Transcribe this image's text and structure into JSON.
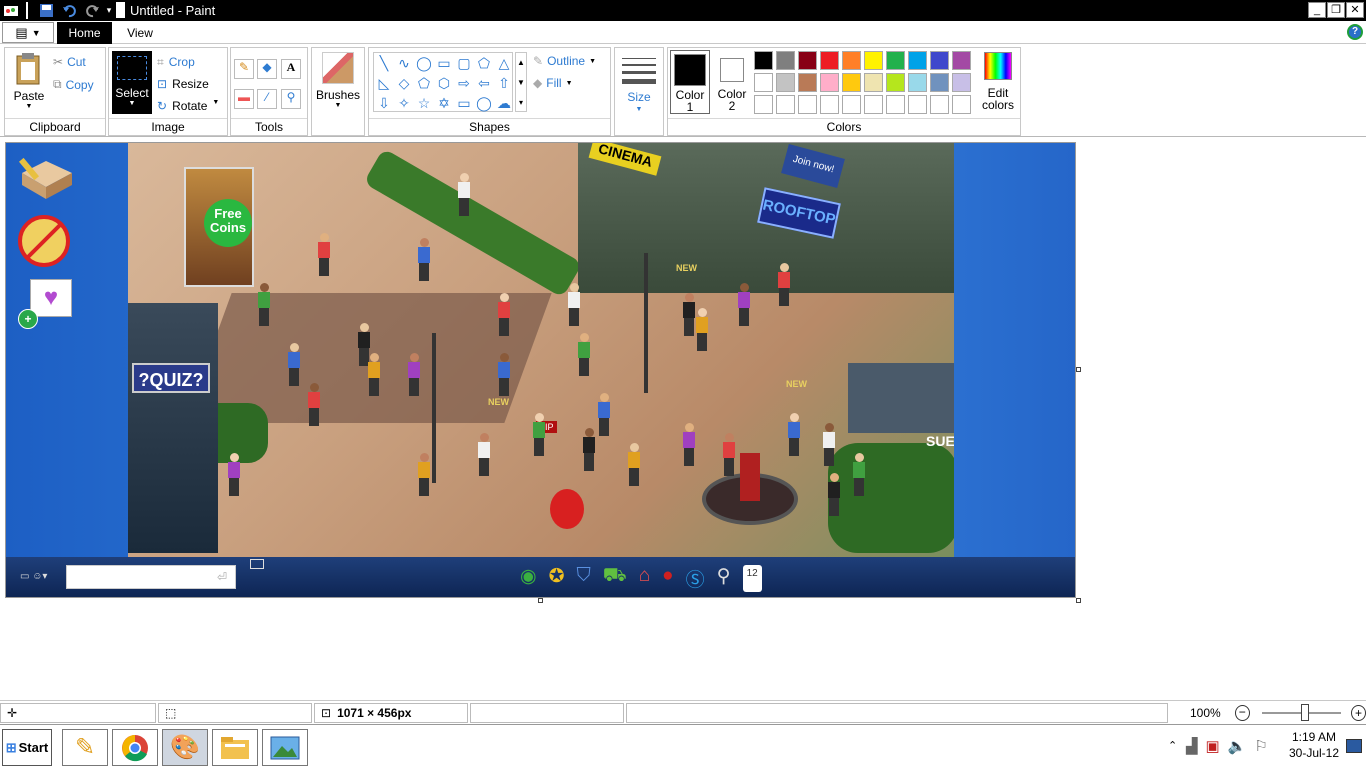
{
  "window": {
    "title": "Untitled - Paint",
    "minimize": "_",
    "restore": "❐",
    "close": "✕"
  },
  "tabs": {
    "file": "▤",
    "home": "Home",
    "view": "View",
    "help": "?"
  },
  "clipboard": {
    "paste": "Paste",
    "cut": "Cut",
    "copy": "Copy",
    "label": "Clipboard"
  },
  "image_group": {
    "select": "Select",
    "crop": "Crop",
    "resize": "Resize",
    "rotate": "Rotate",
    "label": "Image"
  },
  "tools": {
    "label": "Tools",
    "brushes": "Brushes"
  },
  "shapes": {
    "outline": "Outline",
    "fill": "Fill",
    "label": "Shapes"
  },
  "size": {
    "label": "Size"
  },
  "colors": {
    "color1_l1": "Color",
    "color1_l2": "1",
    "color2_l1": "Color",
    "color2_l2": "2",
    "edit_l1": "Edit",
    "edit_l2": "colors",
    "label": "Colors",
    "row1": [
      "#000000",
      "#7f7f7f",
      "#880015",
      "#ed1c24",
      "#ff7f27",
      "#fff200",
      "#22b14c",
      "#00a2e8",
      "#3f48cc",
      "#a349a4"
    ],
    "row2": [
      "#ffffff",
      "#c3c3c3",
      "#b97a57",
      "#ffaec9",
      "#ffc90e",
      "#efe4b0",
      "#b5e61d",
      "#99d9ea",
      "#7092be",
      "#c8bfe7"
    ],
    "row3": [
      "#ffffff",
      "#ffffff",
      "#ffffff",
      "#ffffff",
      "#ffffff",
      "#ffffff",
      "#ffffff",
      "#ffffff",
      "#ffffff",
      "#ffffff"
    ]
  },
  "scene": {
    "free_coins": "Free Coins",
    "cinema": "CINEMA",
    "rooftop": "ROOFTOP",
    "join_now": "Join now!",
    "quiz": "?QUIZ?",
    "new1": "NEW",
    "new2": "NEW",
    "new3": "NEW",
    "vip": "VIP",
    "sub": "SUE",
    "calendar": "12"
  },
  "status": {
    "dimensions": "1071 × 456px",
    "zoom": "100%"
  },
  "taskbar": {
    "start": "Start",
    "time": "1:19 AM",
    "date": "30-Jul-12"
  }
}
